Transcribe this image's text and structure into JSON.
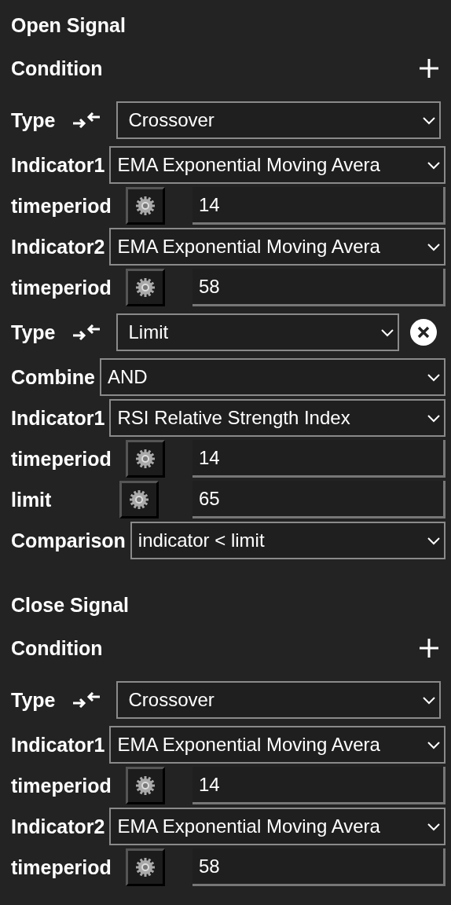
{
  "sections": [
    {
      "title": "Open Signal",
      "condition_label": "Condition",
      "items": [
        {
          "kind": "type",
          "label": "Type",
          "value": "Crossover",
          "removable": false
        },
        {
          "kind": "select",
          "label": "Indicator1",
          "value": "EMA Exponential Moving Avera"
        },
        {
          "kind": "number",
          "label": "timeperiod",
          "value": "14"
        },
        {
          "kind": "select",
          "label": "Indicator2",
          "value": "EMA Exponential Moving Avera"
        },
        {
          "kind": "number",
          "label": "timeperiod",
          "value": "58"
        },
        {
          "kind": "type",
          "label": "Type",
          "value": "Limit",
          "removable": true
        },
        {
          "kind": "select",
          "label": "Combine",
          "value": "AND"
        },
        {
          "kind": "select",
          "label": "Indicator1",
          "value": "RSI Relative Strength Index"
        },
        {
          "kind": "number",
          "label": "timeperiod",
          "value": "14"
        },
        {
          "kind": "number",
          "label": "limit",
          "value": "65"
        },
        {
          "kind": "select",
          "label": "Comparison",
          "value": "indicator < limit"
        }
      ]
    },
    {
      "title": "Close Signal",
      "condition_label": "Condition",
      "items": [
        {
          "kind": "type",
          "label": "Type",
          "value": "Crossover",
          "removable": false
        },
        {
          "kind": "select",
          "label": "Indicator1",
          "value": "EMA Exponential Moving Avera"
        },
        {
          "kind": "number",
          "label": "timeperiod",
          "value": "14"
        },
        {
          "kind": "select",
          "label": "Indicator2",
          "value": "EMA Exponential Moving Avera"
        },
        {
          "kind": "number",
          "label": "timeperiod",
          "value": "58"
        }
      ]
    }
  ]
}
